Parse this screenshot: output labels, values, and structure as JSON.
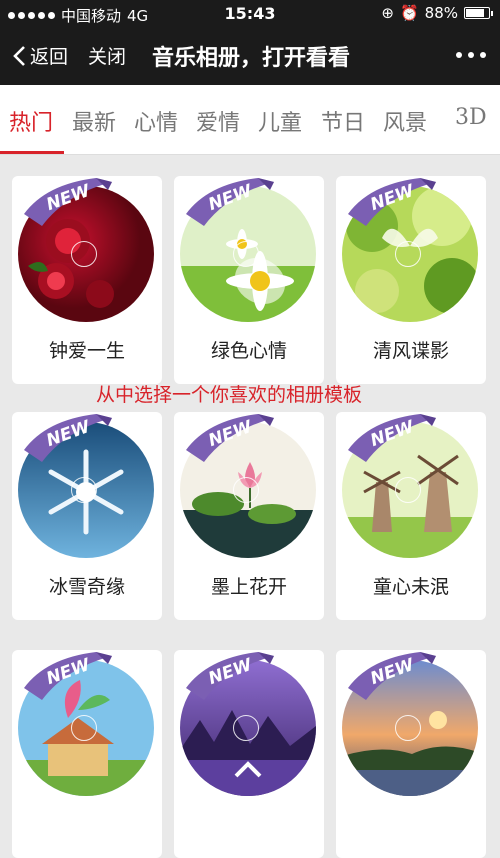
{
  "status": {
    "carrier": "中国移动",
    "network": "4G",
    "time": "15:43",
    "battery_text": "88%",
    "battery_level": 0.88
  },
  "nav": {
    "back_label": "返回",
    "close_label": "关闭",
    "title": "音乐相册，打开看看"
  },
  "tabs": [
    "热门",
    "最新",
    "心情",
    "爱情",
    "儿童",
    "节日",
    "风景",
    "3D"
  ],
  "active_tab": 0,
  "badge_text": "NEW",
  "overlay_text": "从中选择一个你喜欢的相册模板",
  "cards": [
    {
      "label": "钟爱一生",
      "theme": "roses"
    },
    {
      "label": "绿色心情",
      "theme": "daisy"
    },
    {
      "label": "清风谍影",
      "theme": "butterfly"
    },
    {
      "label": "冰雪奇缘",
      "theme": "snowflake"
    },
    {
      "label": "墨上花开",
      "theme": "lotus"
    },
    {
      "label": "童心未泯",
      "theme": "windmill"
    },
    {
      "label": "",
      "theme": "cartoon-house"
    },
    {
      "label": "",
      "theme": "purple-lake"
    },
    {
      "label": "",
      "theme": "sunset-river"
    }
  ],
  "colors": {
    "accent": "#d8232a",
    "badge": "#7b5fb3",
    "bar": "#1b1b1b"
  }
}
